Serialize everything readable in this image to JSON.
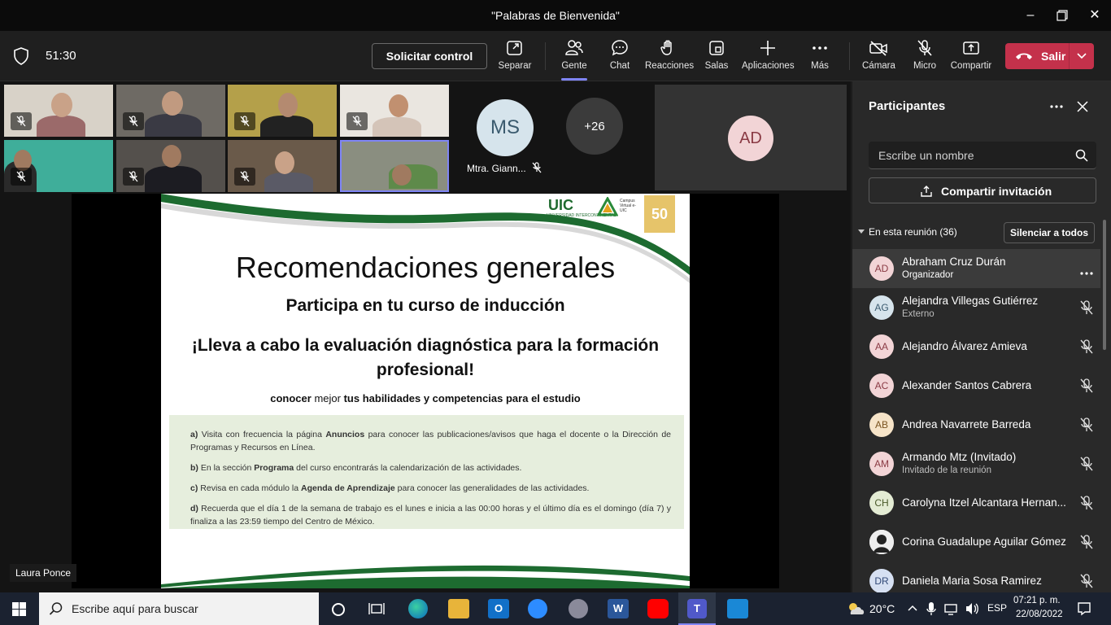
{
  "window": {
    "title": "\"Palabras de Bienvenida\""
  },
  "toolbar": {
    "timer": "51:30",
    "request_control": "Solicitar control",
    "items": [
      {
        "label": "Separar",
        "icon": "popout-icon"
      },
      {
        "label": "Gente",
        "icon": "people-icon"
      },
      {
        "label": "Chat",
        "icon": "chat-icon"
      },
      {
        "label": "Reacciones",
        "icon": "reactions-icon"
      },
      {
        "label": "Salas",
        "icon": "rooms-icon"
      },
      {
        "label": "Aplicaciones",
        "icon": "apps-plus-icon"
      },
      {
        "label": "Más",
        "icon": "more-icon"
      },
      {
        "label": "Cámara",
        "icon": "camera-off-icon"
      },
      {
        "label": "Micro",
        "icon": "mic-off-icon"
      },
      {
        "label": "Compartir",
        "icon": "share-icon"
      }
    ],
    "leave": "Salir"
  },
  "stage": {
    "tiles_extra": {
      "ms_initials": "MS",
      "ms_name": "Mtra. Giann...",
      "more_count": "+26",
      "ad_initials": "AD"
    },
    "presenter_name": "Laura Ponce"
  },
  "slide": {
    "logo_text": "UIC",
    "logo_sub": "UNIVERSIDAD INTERCONTINENTAL",
    "campus_text": "Campus Virtual e-UIC",
    "anniversary": "50",
    "title": "Recomendaciones generales",
    "subtitle": "Participa en tu curso de inducción",
    "headline": "¡Lleva a cabo la evaluación diagnóstica para la formación profesional!",
    "small_a": "conocer",
    "small_b": "mejor",
    "small_c": "tus habilidades y competencias para el estudio",
    "items": [
      {
        "prefix": "a)",
        "pre": "Visita con frecuencia la página",
        "strong": "Anuncios",
        "post": "para conocer las publicaciones/avisos que haga el docente o la Dirección de Programas y Recursos en Línea."
      },
      {
        "prefix": "b)",
        "pre": "En la sección",
        "strong": "Programa",
        "post": "del curso encontrarás la calendarización de las actividades."
      },
      {
        "prefix": "c)",
        "pre": "Revisa en cada módulo la",
        "strong": "Agenda de Aprendizaje",
        "post": "para conocer las generalidades de las actividades."
      },
      {
        "prefix": "d)",
        "pre": "Recuerda que el día 1 de la semana de trabajo es el lunes e inicia a las 00:00 horas y el último día es el domingo (día 7) y finaliza a las 23:59 tiempo del Centro de México.",
        "strong": "",
        "post": ""
      }
    ]
  },
  "panel": {
    "title": "Participantes",
    "search_placeholder": "Escribe un nombre",
    "invite": "Compartir invitación",
    "section": "En esta reunión (36)",
    "mute_all": "Silenciar a todos",
    "participants": [
      {
        "initials": "AD",
        "name": "Abraham Cruz Durán",
        "role": "Organizador",
        "color": "#f2d4d6",
        "text": "#8a3a44"
      },
      {
        "initials": "AG",
        "name": "Alejandra Villegas Gutiérrez",
        "role": "Externo",
        "color": "#d6e4ec",
        "text": "#3a5a6e"
      },
      {
        "initials": "AA",
        "name": "Alejandro Álvarez Amieva",
        "role": "",
        "color": "#f2d4d6",
        "text": "#8a3a44"
      },
      {
        "initials": "AC",
        "name": "Alexander Santos Cabrera",
        "role": "",
        "color": "#f2d4d6",
        "text": "#8a3a44"
      },
      {
        "initials": "AB",
        "name": "Andrea Navarrete Barreda",
        "role": "",
        "color": "#f6e4c8",
        "text": "#7a5420"
      },
      {
        "initials": "AM",
        "name": "Armando Mtz (Invitado)",
        "role": "Invitado de la reunión",
        "color": "#f2d4d6",
        "text": "#8a3a44"
      },
      {
        "initials": "CH",
        "name": "Carolyna Itzel Alcantara Hernan...",
        "role": "",
        "color": "#e4ecd4",
        "text": "#4a5a2a"
      },
      {
        "initials": "",
        "name": "Corina Guadalupe Aguilar Gómez",
        "role": "",
        "color": "#ffffff",
        "text": "#000000"
      },
      {
        "initials": "DR",
        "name": "Daniela Maria Sosa Ramirez",
        "role": "",
        "color": "#d6e0f2",
        "text": "#334a78"
      }
    ]
  },
  "taskbar": {
    "search_placeholder": "Escribe aquí para buscar",
    "temperature": "20°C",
    "language": "ESP",
    "time": "07:21 p. m.",
    "date": "22/08/2022"
  }
}
